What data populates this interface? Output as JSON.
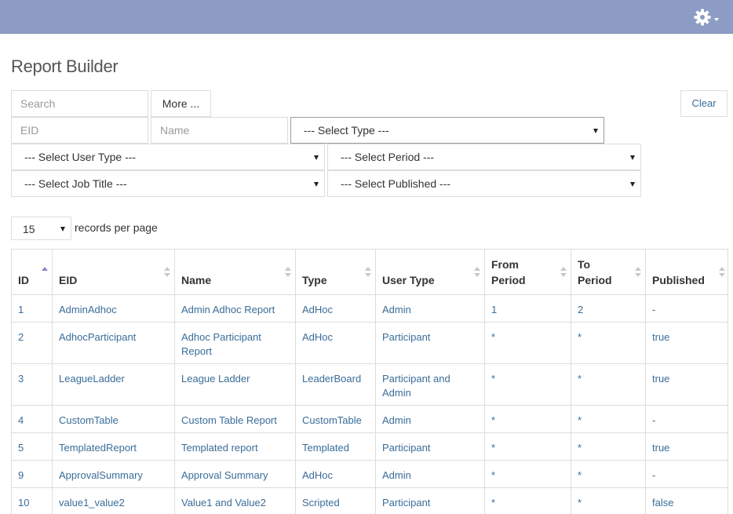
{
  "header": {
    "settings_icon": "gear-icon",
    "settings_caret_icon": "caret-down-icon",
    "bar_color": "#8c9cc4"
  },
  "page": {
    "title": "Report Builder"
  },
  "filters": {
    "search_placeholder": "Search",
    "more_label": "More ...",
    "clear_label": "Clear",
    "eid_placeholder": "EID",
    "name_placeholder": "Name",
    "type_select": "--- Select Type ---",
    "user_type_select": "--- Select User Type ---",
    "period_select": "--- Select Period ---",
    "job_title_select": "--- Select Job Title ---",
    "published_select": "--- Select Published ---"
  },
  "paging": {
    "per_page_value": "15",
    "per_page_label": "records per page"
  },
  "table": {
    "columns": {
      "id": "ID",
      "eid": "EID",
      "name": "Name",
      "type": "Type",
      "user_type": "User Type",
      "from_period_line1": "From",
      "from_period_line2": "Period",
      "to_period_line1": "To",
      "to_period_line2": "Period",
      "published": "Published"
    },
    "sorted_column": "ID",
    "rows": [
      {
        "id": "1",
        "eid": "AdminAdhoc",
        "name": "Admin Adhoc Report",
        "type": "AdHoc",
        "user_type": "Admin",
        "from_period": "1",
        "to_period": "2",
        "published": "-"
      },
      {
        "id": "2",
        "eid": "AdhocParticipant",
        "name": "Adhoc Participant Report",
        "type": "AdHoc",
        "user_type": "Participant",
        "from_period": "*",
        "to_period": "*",
        "published": "true"
      },
      {
        "id": "3",
        "eid": "LeagueLadder",
        "name": "League Ladder",
        "type": "LeaderBoard",
        "user_type": "Participant and Admin",
        "from_period": "*",
        "to_period": "*",
        "published": "true"
      },
      {
        "id": "4",
        "eid": "CustomTable",
        "name": "Custom Table Report",
        "type": "CustomTable",
        "user_type": "Admin",
        "from_period": "*",
        "to_period": "*",
        "published": "-"
      },
      {
        "id": "5",
        "eid": "TemplatedReport",
        "name": "Templated report",
        "type": "Templated",
        "user_type": "Participant",
        "from_period": "*",
        "to_period": "*",
        "published": "true"
      },
      {
        "id": "9",
        "eid": "ApprovalSummary",
        "name": "Approval Summary",
        "type": "AdHoc",
        "user_type": "Admin",
        "from_period": "*",
        "to_period": "*",
        "published": "-"
      },
      {
        "id": "10",
        "eid": "value1_value2",
        "name": "Value1 and Value2",
        "type": "Scripted",
        "user_type": "Participant",
        "from_period": "*",
        "to_period": "*",
        "published": "false"
      }
    ]
  }
}
